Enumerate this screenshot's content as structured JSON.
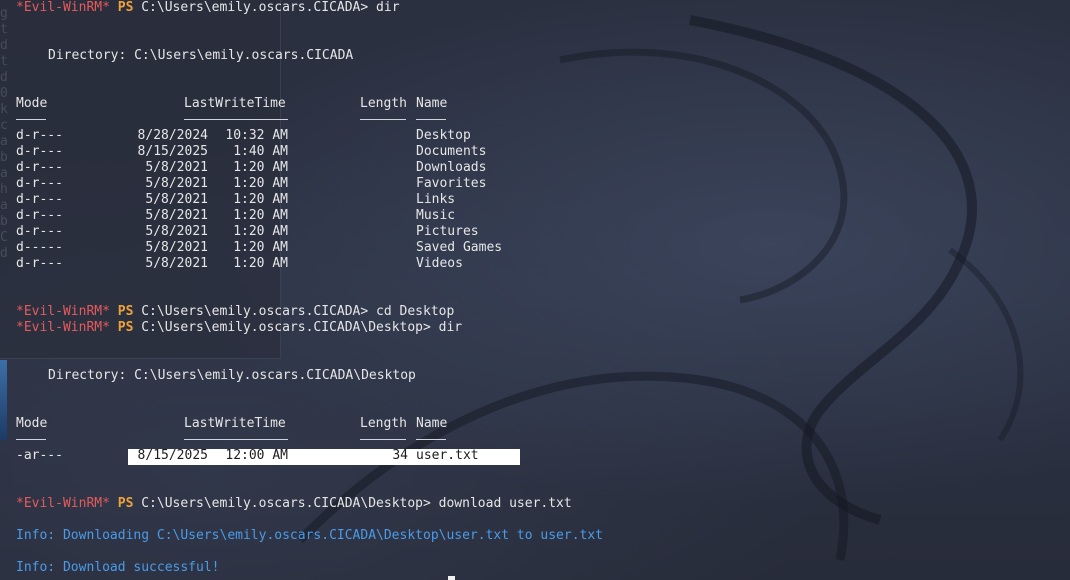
{
  "session": {
    "prompt_tag": "*Evil-WinRM*",
    "ps_label": "PS",
    "commands": [
      {
        "path": "C:\\Users\\emily.oscars.CICADA>",
        "cmd": "dir"
      },
      {
        "path": "C:\\Users\\emily.oscars.CICADA>",
        "cmd": "cd Desktop"
      },
      {
        "path": "C:\\Users\\emily.oscars.CICADA\\Desktop>",
        "cmd": "dir"
      },
      {
        "path": "C:\\Users\\emily.oscars.CICADA\\Desktop>",
        "cmd": "download user.txt"
      }
    ]
  },
  "listing1": {
    "directory_label": "Directory: C:\\Users\\emily.oscars.CICADA",
    "headers": {
      "mode": "Mode",
      "time": "LastWriteTime",
      "length": "Length",
      "name": "Name"
    },
    "rows": [
      {
        "mode": "d-r---",
        "date": "8/28/2024",
        "time": "10:32 AM",
        "length": "",
        "name": "Desktop"
      },
      {
        "mode": "d-r---",
        "date": "8/15/2025",
        "time": "1:40 AM",
        "length": "",
        "name": "Documents"
      },
      {
        "mode": "d-r---",
        "date": "5/8/2021",
        "time": "1:20 AM",
        "length": "",
        "name": "Downloads"
      },
      {
        "mode": "d-r---",
        "date": "5/8/2021",
        "time": "1:20 AM",
        "length": "",
        "name": "Favorites"
      },
      {
        "mode": "d-r---",
        "date": "5/8/2021",
        "time": "1:20 AM",
        "length": "",
        "name": "Links"
      },
      {
        "mode": "d-r---",
        "date": "5/8/2021",
        "time": "1:20 AM",
        "length": "",
        "name": "Music"
      },
      {
        "mode": "d-r---",
        "date": "5/8/2021",
        "time": "1:20 AM",
        "length": "",
        "name": "Pictures"
      },
      {
        "mode": "d-----",
        "date": "5/8/2021",
        "time": "1:20 AM",
        "length": "",
        "name": "Saved Games"
      },
      {
        "mode": "d-r---",
        "date": "5/8/2021",
        "time": "1:20 AM",
        "length": "",
        "name": "Videos"
      }
    ]
  },
  "listing2": {
    "directory_label": "Directory: C:\\Users\\emily.oscars.CICADA\\Desktop",
    "headers": {
      "mode": "Mode",
      "time": "LastWriteTime",
      "length": "Length",
      "name": "Name"
    },
    "rows": [
      {
        "mode": "-ar---",
        "date": "8/15/2025",
        "time": "12:00 AM",
        "length": "34",
        "name": "user.txt"
      }
    ]
  },
  "info": {
    "downloading": "Info: Downloading C:\\Users\\emily.oscars.CICADA\\Desktop\\user.txt to user.txt",
    "success": "Info: Download successful!"
  },
  "background_text": "g\nt\nd\nt\nd\n0\nk\nc\na\nb\na\nh\na\nb\nC\nd",
  "colors": {
    "prompt_tag": "#e55b5b",
    "ps": "#f0a23a",
    "info": "#4a9be8",
    "highlight": "#ffffff"
  }
}
